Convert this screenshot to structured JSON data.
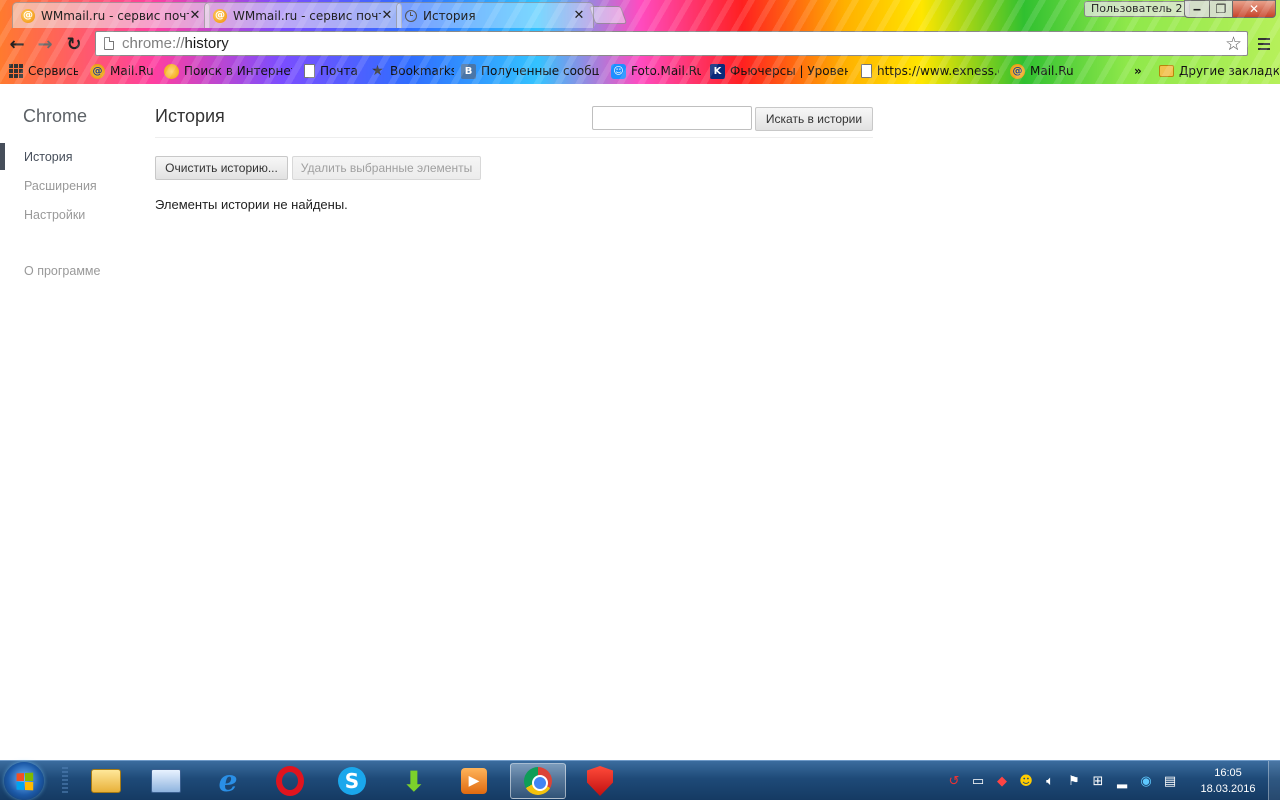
{
  "browser": {
    "tabs": [
      {
        "title": "WMmail.ru - сервис почт",
        "active": false
      },
      {
        "title": "WMmail.ru - сервис почт",
        "active": false
      },
      {
        "title": "История",
        "active": true
      }
    ],
    "profile_label": "Пользователь 2",
    "url_scheme": "chrome://",
    "url_path": "history",
    "bookmarks": [
      {
        "label": "Сервисы",
        "icon": "apps-icon"
      },
      {
        "label": "Mail.Ru",
        "icon": "mailru-icon"
      },
      {
        "label": "Поиск в Интернете",
        "icon": "search-icon"
      },
      {
        "label": "Почта",
        "icon": "page-icon"
      },
      {
        "label": "Bookmarks",
        "icon": "star-icon"
      },
      {
        "label": "Полученные сообще",
        "icon": "vk-icon"
      },
      {
        "label": "Foto.Mail.Ru",
        "icon": "foto-icon"
      },
      {
        "label": "Фьючерсы | Уровень",
        "icon": "futures-icon"
      },
      {
        "label": "https://www.exness.c",
        "icon": "page-icon"
      },
      {
        "label": "Mail.Ru",
        "icon": "mailru-icon"
      }
    ],
    "bookmarks_overflow": "»",
    "other_bookmarks": "Другие закладки"
  },
  "sidebar": {
    "brand": "Chrome",
    "items": [
      {
        "label": "История",
        "selected": true
      },
      {
        "label": "Расширения",
        "selected": false
      },
      {
        "label": "Настройки",
        "selected": false
      }
    ],
    "about": "О программе"
  },
  "main": {
    "title": "История",
    "search_button": "Искать в истории",
    "search_value": "",
    "clear_button": "Очистить историю...",
    "delete_button": "Удалить выбранные элементы",
    "empty_message": "Элементы истории не найдены."
  },
  "taskbar": {
    "time": "16:05",
    "date": "18.03.2016"
  },
  "colors": {
    "sidebar_selected": "#464e5a",
    "sidebar_muted": "#999999",
    "close_button": "#c7442b"
  }
}
